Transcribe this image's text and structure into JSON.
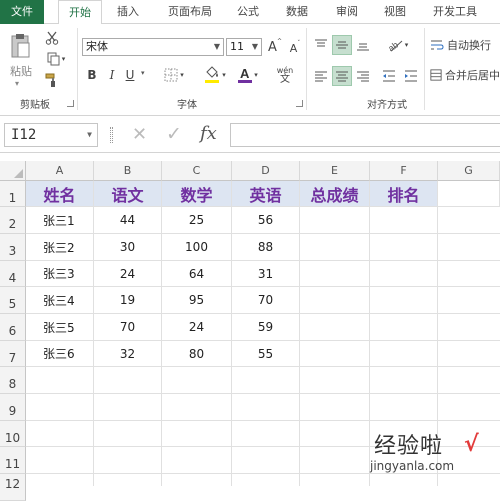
{
  "tabs": [
    "文件",
    "开始",
    "插入",
    "页面布局",
    "公式",
    "数据",
    "审阅",
    "视图",
    "开发工具"
  ],
  "clipboard": {
    "paste_label": "粘贴",
    "group_label": "剪贴板"
  },
  "font": {
    "name": "宋体",
    "size": "11",
    "group_label": "字体",
    "bold": "B",
    "italic": "I",
    "underline": "U",
    "wen": "wén",
    "wen_char": "文",
    "grow": "A",
    "shrink": "A"
  },
  "alignment": {
    "wrap_text": "自动换行",
    "merge_center": "合并后居中",
    "group_label": "对齐方式"
  },
  "formula_bar": {
    "name_box": "I12",
    "fx": "fx",
    "cancel": "✕",
    "enter": "✓"
  },
  "columns": [
    "A",
    "B",
    "C",
    "D",
    "E",
    "F",
    "G"
  ],
  "rows": [
    "1",
    "2",
    "3",
    "4",
    "5",
    "6",
    "7",
    "8",
    "9",
    "10",
    "11",
    "12"
  ],
  "table": {
    "headers": [
      "姓名",
      "语文",
      "数学",
      "英语",
      "总成绩",
      "排名"
    ],
    "data": [
      [
        "张三1",
        "44",
        "25",
        "56"
      ],
      [
        "张三2",
        "30",
        "100",
        "88"
      ],
      [
        "张三3",
        "24",
        "64",
        "31"
      ],
      [
        "张三4",
        "19",
        "95",
        "70"
      ],
      [
        "张三5",
        "70",
        "24",
        "59"
      ],
      [
        "张三6",
        "32",
        "80",
        "55"
      ]
    ]
  },
  "watermark": {
    "title": "经验啦",
    "url": "jingyanla.com",
    "check": "√"
  },
  "colors": {
    "excel_green": "#217346",
    "header_fill": "#dde5f2",
    "header_text": "#7030a0",
    "watermark_check": "#e23b3b"
  }
}
